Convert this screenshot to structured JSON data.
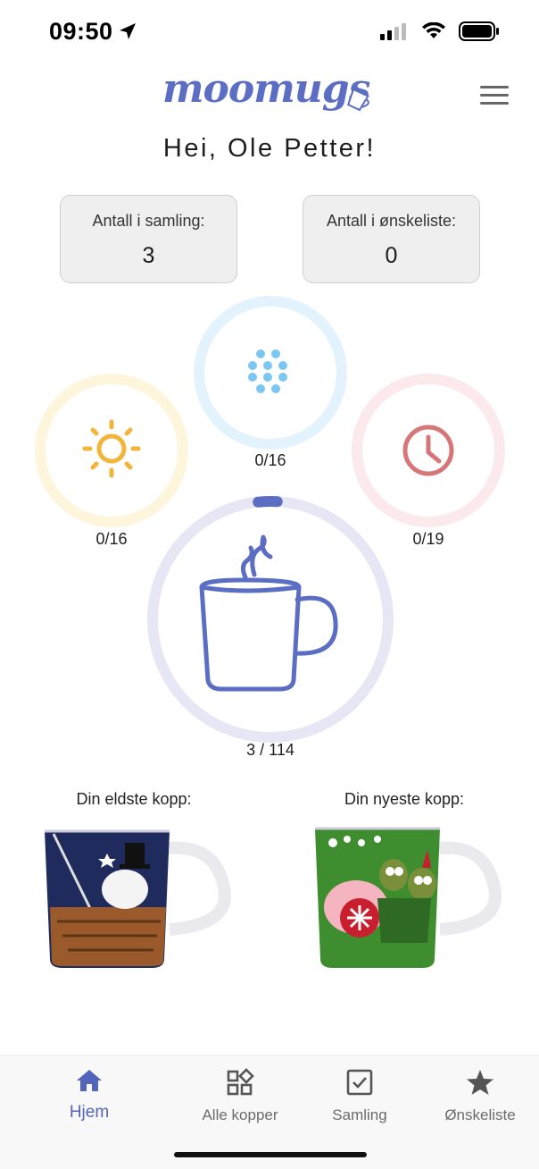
{
  "status_bar": {
    "time": "09:50"
  },
  "header": {
    "logo_text": "moomugs",
    "greeting": "Hei, Ole Petter!"
  },
  "stats": {
    "collection_label": "Antall i samling:",
    "collection_value": "3",
    "wishlist_label": "Antall i ønskeliste:",
    "wishlist_value": "0"
  },
  "progress": {
    "winter": {
      "label": "0/16",
      "fraction": 0,
      "color": "#7cc7f2",
      "track": "#e3f3fd"
    },
    "summer": {
      "label": "0/16",
      "fraction": 0,
      "color": "#f3b43a",
      "track": "#fdf6dc"
    },
    "clock": {
      "label": "0/19",
      "fraction": 0,
      "color": "#d67678",
      "track": "#fbe9ec"
    },
    "total": {
      "label": "3 / 114",
      "fraction": 0.026,
      "color": "#5b6ec3",
      "track": "#e6e6f4"
    }
  },
  "mugs": {
    "oldest_caption": "Din eldste kopp:",
    "newest_caption": "Din nyeste kopp:"
  },
  "tabs": [
    {
      "label": "Hjem",
      "icon": "home-icon",
      "active": true
    },
    {
      "label": "Alle kopper",
      "icon": "grid-icon",
      "active": false
    },
    {
      "label": "Samling",
      "icon": "checkbox-icon",
      "active": false
    },
    {
      "label": "Ønskeliste",
      "icon": "star-icon",
      "active": false
    }
  ],
  "colors": {
    "accent": "#5265bb"
  }
}
